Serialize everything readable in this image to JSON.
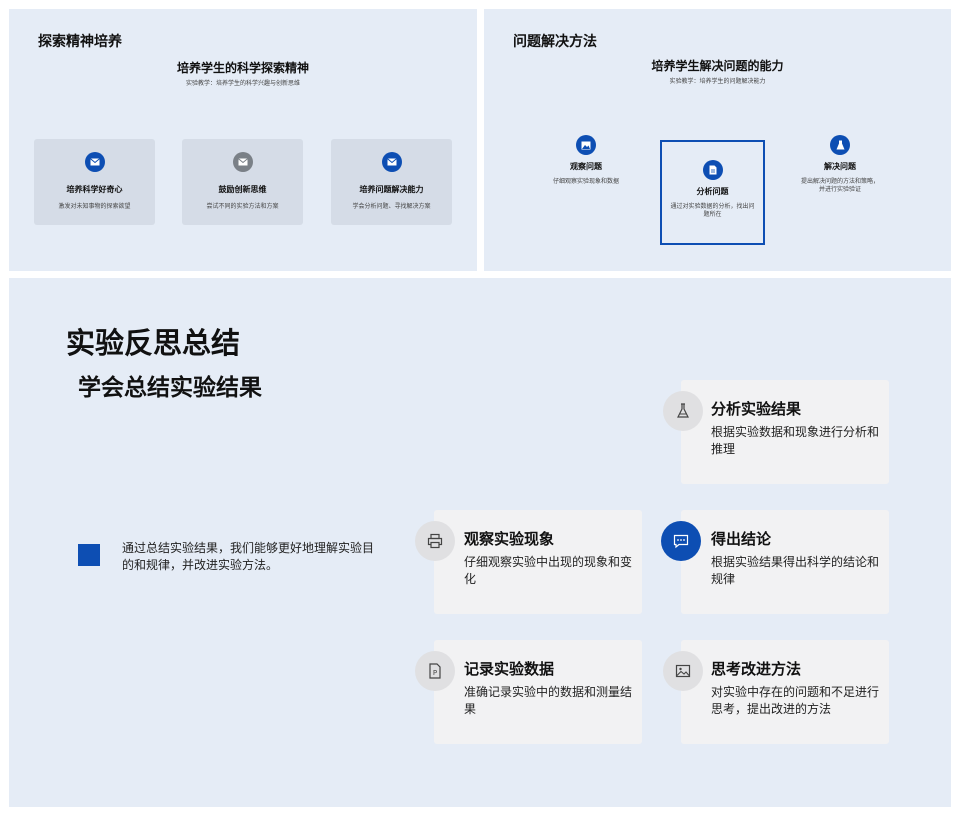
{
  "panel1": {
    "title": "探索精神培养",
    "subtitle": "培养学生的科学探索精神",
    "note": "实验教学：培养学生的科学兴趣与创新思维",
    "cards": [
      {
        "title": "培养科学好奇心",
        "desc": "激发对未知事物的探索欲望",
        "icon": "mail-icon"
      },
      {
        "title": "鼓励创新思维",
        "desc": "尝试不同的实验方法和方案",
        "icon": "mail-icon"
      },
      {
        "title": "培养问题解决能力",
        "desc": "学会分析问题、寻找解决方案",
        "icon": "mail-icon"
      }
    ]
  },
  "panel2": {
    "title": "问题解决方法",
    "subtitle": "培养学生解决问题的能力",
    "note": "实验教学：培养学生的问题解决能力",
    "steps": [
      {
        "title": "观察问题",
        "desc": "仔细观察实验现象和数据",
        "icon": "image-icon"
      },
      {
        "title": "分析问题",
        "desc": "通过对实验数据的分析，找出问题所在",
        "icon": "document-icon"
      },
      {
        "title": "解决问题",
        "desc": "提出解决问题的方法和策略，并进行实验验证",
        "icon": "flask-icon"
      }
    ]
  },
  "panel3": {
    "title": "实验反思总结",
    "subtitle": "学会总结实验结果",
    "bullet_text": "通过总结实验结果，我们能够更好地理解实验目的和规律，并改进实验方法。",
    "cards": [
      {
        "title": "分析实验结果",
        "desc": "根据实验数据和现象进行分析和推理",
        "icon": "flask-icon"
      },
      {
        "title": "观察实验现象",
        "desc": "仔细观察实验中出现的现象和变化",
        "icon": "printer-icon"
      },
      {
        "title": "得出结论",
        "desc": "根据实验结果得出科学的结论和规律",
        "icon": "chat-icon"
      },
      {
        "title": "记录实验数据",
        "desc": "准确记录实验中的数据和测量结果",
        "icon": "document-p-icon"
      },
      {
        "title": "思考改进方法",
        "desc": "对实验中存在的问题和不足进行思考，提出改进的方法",
        "icon": "image-icon"
      }
    ]
  },
  "colors": {
    "accent": "#0d4eb3",
    "panel_bg": "#e5ecf6",
    "card_bg": "#f2f2f3",
    "icon_grey": "#7a8087"
  }
}
